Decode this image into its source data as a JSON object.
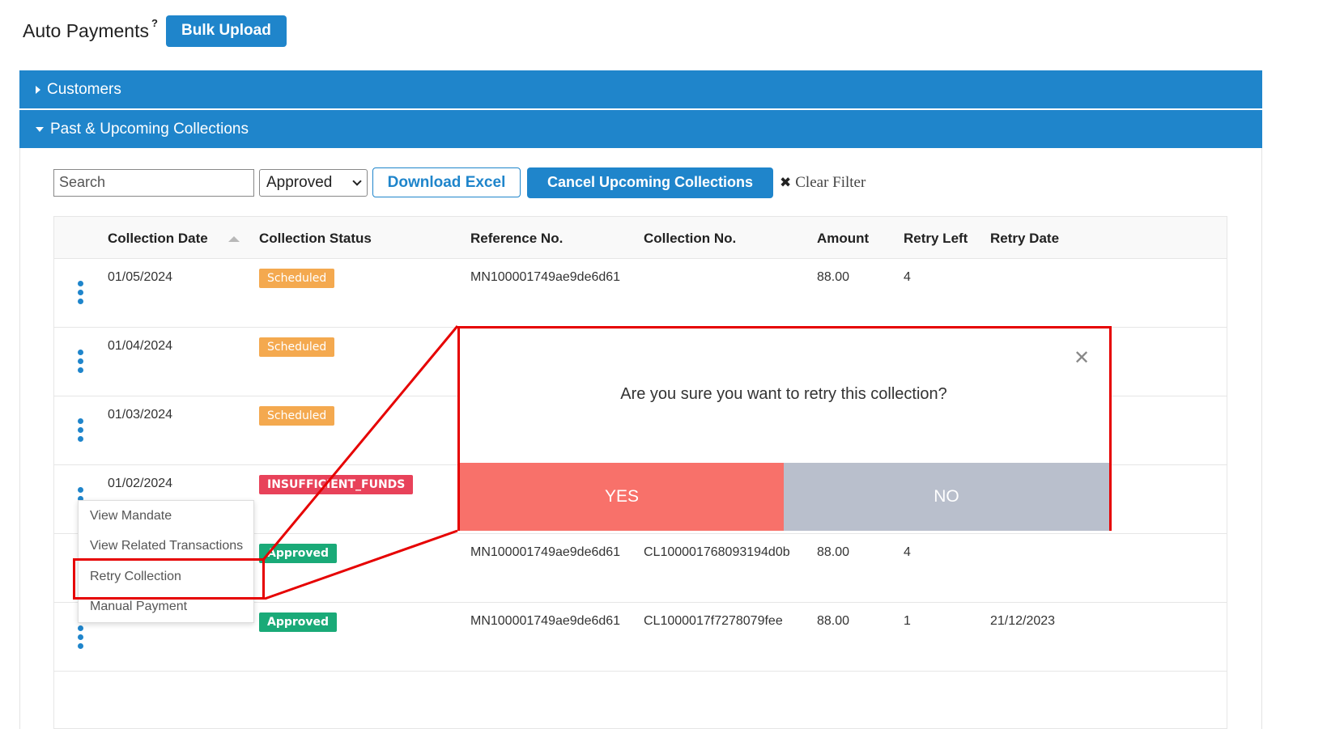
{
  "header": {
    "title": "Auto Payments",
    "help_mark": "?",
    "bulk_upload_label": "Bulk Upload"
  },
  "accordions": {
    "customers_label": "Customers",
    "collections_label": "Past & Upcoming Collections"
  },
  "toolbar": {
    "search_placeholder": "Search",
    "status_selected": "Approved",
    "download_label": "Download Excel",
    "cancel_label": "Cancel Upcoming Collections",
    "clear_filter_label": "Clear Filter",
    "clear_icon": "✖"
  },
  "table": {
    "columns": [
      "Collection Date",
      "Collection Status",
      "Reference No.",
      "Collection No.",
      "Amount",
      "Retry Left",
      "Retry Date"
    ],
    "rows": [
      {
        "date": "01/05/2024",
        "status": "Scheduled",
        "reference": "MN100001749ae9de6d61",
        "collection": "",
        "amount": "88.00",
        "retry_left": "4",
        "retry_date": ""
      },
      {
        "date": "01/04/2024",
        "status": "Scheduled",
        "reference": "",
        "collection": "",
        "amount": "",
        "retry_left": "",
        "retry_date": ""
      },
      {
        "date": "01/03/2024",
        "status": "Scheduled",
        "reference": "",
        "collection": "",
        "amount": "",
        "retry_left": "",
        "retry_date": ""
      },
      {
        "date": "01/02/2024",
        "status": "INSUFFICIENT_FUNDS",
        "reference": "",
        "collection": "",
        "amount": "",
        "retry_left": "",
        "retry_date": ""
      },
      {
        "date": "",
        "status": "Approved",
        "reference": "MN100001749ae9de6d61",
        "collection": "CL100001768093194d0b",
        "amount": "88.00",
        "retry_left": "4",
        "retry_date": ""
      },
      {
        "date": "",
        "status": "Approved",
        "reference": "MN100001749ae9de6d61",
        "collection": "CL1000017f7278079fee",
        "amount": "88.00",
        "retry_left": "1",
        "retry_date": "21/12/2023"
      }
    ]
  },
  "menu": {
    "items": [
      "View Mandate",
      "View Related Transactions",
      "Retry Collection",
      "Manual Payment"
    ]
  },
  "modal": {
    "message": "Are you sure you want to retry this collection?",
    "close_icon": "✕",
    "yes_label": "YES",
    "no_label": "NO"
  },
  "colors": {
    "primary": "#1f85cb",
    "scheduled": "#f4a94f",
    "insufficient": "#e8425a",
    "approved": "#1aaa78",
    "yes": "#f8716a",
    "no": "#b9bfcc",
    "highlight": "#e60000"
  },
  "icons": {
    "more": "kebab-icon",
    "sort": "sort-asc-icon",
    "close": "close-icon",
    "expand": "caret-icon"
  }
}
